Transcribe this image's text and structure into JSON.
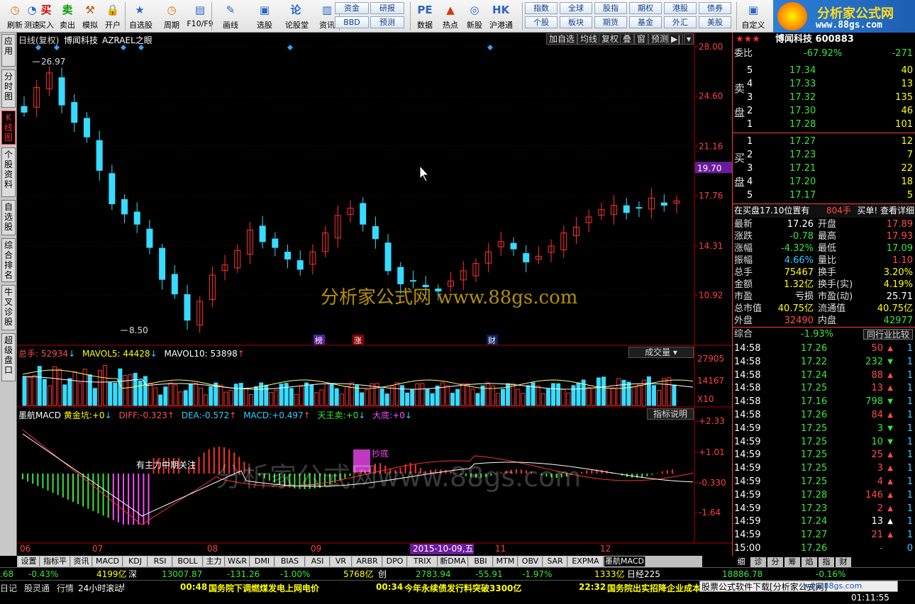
{
  "toolbar": {
    "items": [
      {
        "label": "刷新",
        "icon": "clock-icon"
      },
      {
        "label": "测速",
        "icon": "speed-icon"
      },
      {
        "label": "买入",
        "icon": "buy-icon"
      },
      {
        "label": "卖出",
        "icon": "sell-icon"
      },
      {
        "label": "模拟",
        "icon": "hammer-icon"
      },
      {
        "label": "开户",
        "icon": "lock-icon"
      },
      {
        "label": "自选股",
        "icon": "star-icon"
      },
      {
        "label": "周期",
        "icon": "clock-icon"
      },
      {
        "label": "F10/F9",
        "icon": "f10-icon"
      },
      {
        "label": "画线",
        "icon": "pen-icon"
      },
      {
        "label": "选股",
        "icon": "filter-icon"
      },
      {
        "label": "论股堂",
        "icon": "talk-icon"
      },
      {
        "label": "资讯",
        "icon": "news-icon"
      },
      {
        "label": "数据",
        "icon": "pe-icon"
      },
      {
        "label": "热点",
        "icon": "hot-icon"
      },
      {
        "label": "新股",
        "icon": "new-icon"
      },
      {
        "label": "沪港通",
        "icon": "hk-icon"
      }
    ],
    "mid_buttons": [
      [
        "资金",
        "研报"
      ],
      [
        "BBD",
        "预测"
      ]
    ],
    "right_buttons": [
      [
        "指数",
        "全球",
        "股指",
        "期权",
        "港股",
        "债券"
      ],
      [
        "个股",
        "板块",
        "期货",
        "基金",
        "外汇",
        "美股"
      ]
    ],
    "custom_label": "自定义"
  },
  "brand": {
    "title": "分析家公式网",
    "url": "www.88gs.com"
  },
  "left_tabs": [
    "应用",
    "分时图",
    "K线图",
    "个股资料",
    "自选股",
    "综合排名",
    "牛叉诊股",
    "超级盘口"
  ],
  "chart": {
    "header_title": "日线(复权)",
    "stock_name": "博闻科技",
    "indicator_name": "AZRAEL之眼",
    "menu_buttons": [
      "加自选",
      "均线",
      "复权",
      "叠",
      "窗",
      "预测"
    ],
    "price_axis": [
      "28.00",
      "24.60",
      "21.16",
      "17.76",
      "14.31",
      "10.92"
    ],
    "current_price_tag": "19.70",
    "high_label": "26.97",
    "low_label": "8.50",
    "markers": [
      "榜",
      "涨",
      "财"
    ],
    "watermark": "分析家公式网  www.88gs.com",
    "watermark2": "分析家公式网www.88gs.com",
    "vol_header": {
      "total_label": "总手:",
      "total": "52934",
      "ma5_label": "MAVOL5:",
      "ma5": "44428",
      "ma10_label": "MAVOL10:",
      "ma10": "53898"
    },
    "vol_selector": "成交量",
    "vol_axis": [
      "27905",
      "14167",
      "X10"
    ],
    "macd_header": {
      "name": "墨航MACD",
      "gold_label": "黄金坑:",
      "gold": "+0",
      "diff_label": "DIFF:",
      "diff": "-0.323",
      "dea_label": "DEA:",
      "dea": "-0.572",
      "macd_label": "MACD:",
      "macd": "+0.497",
      "tw_label": "天王卖:",
      "tw": "+0",
      "bottom_label": "大底:",
      "bottom": "+0"
    },
    "macd_button": "指标说明",
    "macd_axis": [
      "+2.33",
      "+1.01",
      "-0.330",
      "-1.64"
    ],
    "macd_text1": "有主力中期关注",
    "macd_text2": "抄底",
    "date_axis": [
      "06",
      "07",
      "08",
      "09",
      "11",
      "12"
    ],
    "cursor_date": "2015-10-09,五"
  },
  "chart_data": {
    "type": "candlestick",
    "x_months": [
      "06",
      "07",
      "08",
      "09",
      "10",
      "11",
      "12"
    ],
    "ylim": [
      8.5,
      28.0
    ],
    "high": 26.97,
    "low": 8.5,
    "last_close": 17.26,
    "close_series": [
      23.5,
      25.2,
      26.2,
      24.0,
      22.8,
      21.8,
      19.5,
      17.2,
      16.5,
      15.8,
      14.2,
      12.0,
      11.0,
      9.2,
      10.5,
      12.3,
      13.0,
      14.0,
      15.4,
      14.6,
      14.2,
      13.4,
      12.7,
      13.9,
      15.2,
      16.4,
      16.9,
      15.8,
      14.8,
      12.6,
      11.7,
      11.9,
      11.5,
      11.2,
      11.9,
      12.6,
      13.1,
      13.9,
      14.6,
      14.1,
      13.2,
      13.6,
      14.3,
      15.2,
      15.6,
      16.3,
      16.8,
      17.1,
      16.6,
      16.9,
      17.6,
      17.1,
      17.4
    ],
    "volume_axis": [
      27905,
      14167
    ],
    "macd_axis": [
      2.33,
      1.01,
      -0.33,
      -1.64
    ],
    "diff": -0.323,
    "dea": -0.572,
    "macd": 0.497
  },
  "quote": {
    "title": "博闻科技 600883",
    "webi_label": "委比",
    "webi": "-67.92%",
    "weicha": "-271",
    "sell_side": "卖盘",
    "buy_side": "买盘",
    "asks": [
      [
        "5",
        "17.34",
        "40"
      ],
      [
        "4",
        "17.33",
        "13"
      ],
      [
        "3",
        "17.32",
        "135"
      ],
      [
        "2",
        "17.30",
        "46"
      ],
      [
        "1",
        "17.28",
        "101"
      ]
    ],
    "bids": [
      [
        "1",
        "17.27",
        "12"
      ],
      [
        "2",
        "17.23",
        "7"
      ],
      [
        "3",
        "17.21",
        "22"
      ],
      [
        "4",
        "17.20",
        "18"
      ],
      [
        "5",
        "17.17",
        "5"
      ]
    ],
    "notice": "在买盘17.10位置有",
    "notice_vol": "804手",
    "notice_tail": "买单! 查看详细",
    "stats": [
      [
        "最新",
        "17.26",
        "开盘",
        "17.89"
      ],
      [
        "涨跌",
        "-0.78",
        "最高",
        "17.93"
      ],
      [
        "涨幅",
        "-4.32%",
        "最低",
        "17.09"
      ],
      [
        "振幅",
        "4.66%",
        "量比",
        "1.10"
      ],
      [
        "总手",
        "75467",
        "换手",
        "3.20%"
      ],
      [
        "金额",
        "1.32亿",
        "换手(实)",
        "4.19%"
      ],
      [
        "市盈",
        "亏损",
        "市盈(动)",
        "25.71"
      ],
      [
        "总市值",
        "40.75亿",
        "流通值",
        "40.75亿"
      ],
      [
        "外盘",
        "32490",
        "内盘",
        "42977"
      ]
    ],
    "composite_label": "综合",
    "composite": "-1.93%",
    "compare": "同行业比较",
    "ticks": [
      [
        "14:58",
        "17.26",
        "50",
        "up",
        "1"
      ],
      [
        "14:58",
        "17.22",
        "232",
        "down",
        "1"
      ],
      [
        "14:58",
        "17.24",
        "88",
        "up",
        "1"
      ],
      [
        "14:58",
        "17.25",
        "13",
        "up",
        "1"
      ],
      [
        "14:58",
        "17.16",
        "798",
        "down",
        "1"
      ],
      [
        "14:58",
        "17.26",
        "84",
        "up",
        "1"
      ],
      [
        "14:59",
        "17.25",
        "3",
        "down",
        "1"
      ],
      [
        "14:59",
        "17.25",
        "10",
        "down",
        "1"
      ],
      [
        "14:59",
        "17.25",
        "25",
        "up",
        "1"
      ],
      [
        "14:59",
        "17.25",
        "3",
        "up",
        "1"
      ],
      [
        "14:59",
        "17.25",
        "4",
        "up",
        "1"
      ],
      [
        "14:59",
        "17.28",
        "146",
        "up",
        "1"
      ],
      [
        "14:59",
        "17.23",
        "2",
        "up",
        "1"
      ],
      [
        "14:59",
        "17.24",
        "13",
        "white",
        "1"
      ],
      [
        "14:59",
        "17.27",
        "21",
        "up",
        "1"
      ],
      [
        "15:00",
        "17.26",
        "-",
        "none",
        "0"
      ]
    ],
    "bottom_tabs": [
      "细",
      "诊",
      "分",
      "筹",
      "焰",
      "指",
      "财"
    ]
  },
  "bottom_tabs": [
    "设置",
    "指标平台",
    "资讯",
    "MACD",
    "KDJ",
    "RSI",
    "BOLL",
    "主力",
    "W&R",
    "DMI",
    "BIAS",
    "ASI",
    "VR",
    "ARBR",
    "DPO",
    "TRIX",
    "新DMA",
    "BBI",
    "MTM",
    "OBV",
    "SAR",
    "EXPMA",
    "墨航MACD"
  ],
  "status": {
    "a": ".68",
    "b": "-0.43%",
    "c": "4199亿",
    "d": "深",
    "e": "13007.87",
    "f": "-131.26",
    "g": "-1.00%",
    "h": "5768亿",
    "i": "创",
    "j": "2783.94",
    "k": "-55.91",
    "l": "-1.97%",
    "m": "1333亿",
    "n": "日经225",
    "o": "18886.78",
    "p": "-0.16%"
  },
  "news": {
    "left": [
      "日记",
      "股灵通",
      "行情",
      "24小时滚动"
    ],
    "items": [
      [
        "00:48",
        "国务院下调燃煤发电上网电价"
      ],
      [
        "00:34",
        "今年永续债发行料突破3300亿"
      ],
      [
        "22:32",
        "国务院出实招降企业成本"
      ]
    ],
    "promo": "股票公式软件下载[分析家公式网]",
    "promo2": "www.88gs.com",
    "clock": "01:11:55"
  }
}
